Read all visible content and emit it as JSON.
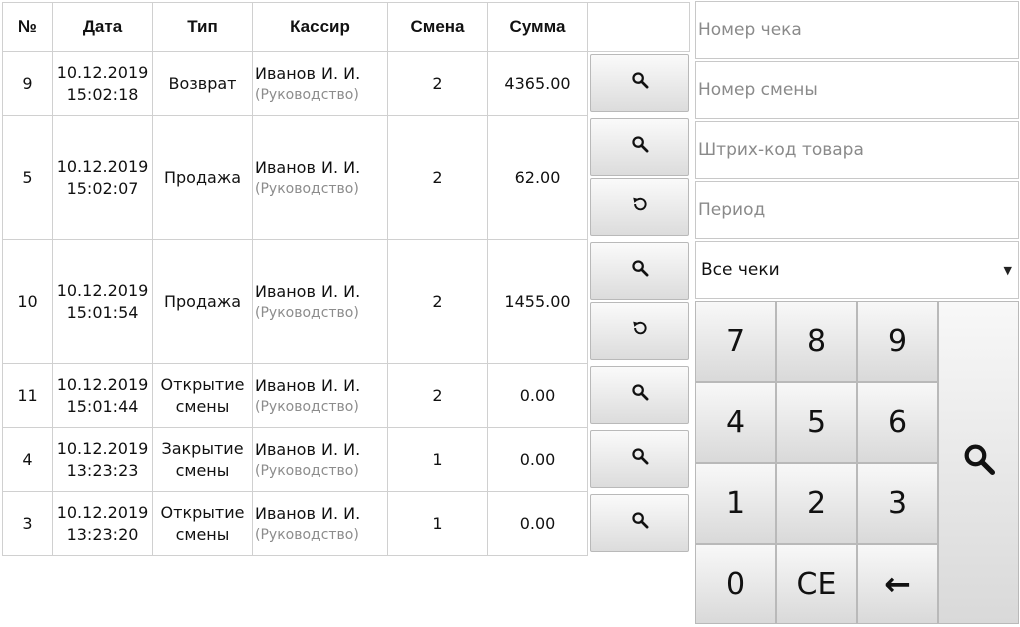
{
  "table": {
    "headers": {
      "num": "№",
      "date": "Дата",
      "type": "Тип",
      "cashier": "Кассир",
      "shift": "Смена",
      "sum": "Сумма"
    },
    "rows": [
      {
        "num": "9",
        "date": "10.12.2019",
        "time": "15:02:18",
        "type_line1": "Возврат",
        "type_line2": "",
        "cashier": "Иванов И. И.",
        "role": "(Руководство)",
        "shift": "2",
        "sum": "4365.00",
        "actions": [
          "search-icon"
        ]
      },
      {
        "num": "5",
        "date": "10.12.2019",
        "time": "15:02:07",
        "type_line1": "Продажа",
        "type_line2": "",
        "cashier": "Иванов И. И.",
        "role": "(Руководство)",
        "shift": "2",
        "sum": "62.00",
        "actions": [
          "search-icon",
          "undo-icon"
        ]
      },
      {
        "num": "10",
        "date": "10.12.2019",
        "time": "15:01:54",
        "type_line1": "Продажа",
        "type_line2": "",
        "cashier": "Иванов И. И.",
        "role": "(Руководство)",
        "shift": "2",
        "sum": "1455.00",
        "actions": [
          "search-icon",
          "undo-icon"
        ]
      },
      {
        "num": "11",
        "date": "10.12.2019",
        "time": "15:01:44",
        "type_line1": "Открытие",
        "type_line2": "смены",
        "cashier": "Иванов И. И.",
        "role": "(Руководство)",
        "shift": "2",
        "sum": "0.00",
        "actions": [
          "search-icon"
        ]
      },
      {
        "num": "4",
        "date": "10.12.2019",
        "time": "13:23:23",
        "type_line1": "Закрытие",
        "type_line2": "смены",
        "cashier": "Иванов И. И.",
        "role": "(Руководство)",
        "shift": "1",
        "sum": "0.00",
        "actions": [
          "search-icon"
        ]
      },
      {
        "num": "3",
        "date": "10.12.2019",
        "time": "13:23:20",
        "type_line1": "Открытие",
        "type_line2": "смены",
        "cashier": "Иванов И. И.",
        "role": "(Руководство)",
        "shift": "1",
        "sum": "0.00",
        "actions": [
          "search-icon"
        ]
      }
    ]
  },
  "filters": {
    "receipt_number_placeholder": "Номер чека",
    "shift_number_placeholder": "Номер смены",
    "barcode_placeholder": "Штрих-код товара",
    "period_placeholder": "Период",
    "receipt_type_selected": "Все чеки"
  },
  "keypad": {
    "k7": "7",
    "k8": "8",
    "k9": "9",
    "k4": "4",
    "k5": "5",
    "k6": "6",
    "k1": "1",
    "k2": "2",
    "k3": "3",
    "k0": "0",
    "ce": "CE",
    "backspace": "←",
    "search": "search-icon"
  }
}
